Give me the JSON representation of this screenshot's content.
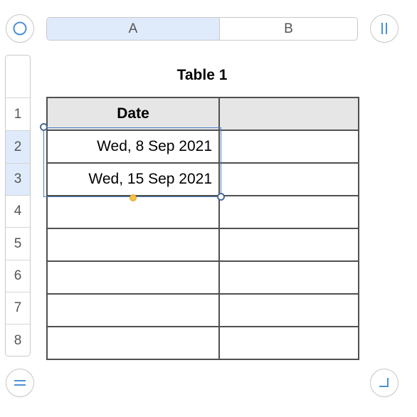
{
  "table": {
    "title": "Table 1",
    "column_headers": [
      "A",
      "B"
    ],
    "row_headers": [
      "",
      "1",
      "2",
      "3",
      "4",
      "5",
      "6",
      "7",
      "8"
    ],
    "header_row": {
      "a": "Date",
      "b": ""
    },
    "rows": [
      {
        "a": "Wed, 8 Sep 2021",
        "b": ""
      },
      {
        "a": "Wed, 15 Sep 2021",
        "b": ""
      },
      {
        "a": "",
        "b": ""
      },
      {
        "a": "",
        "b": ""
      },
      {
        "a": "",
        "b": ""
      },
      {
        "a": "",
        "b": ""
      },
      {
        "a": "",
        "b": ""
      }
    ]
  },
  "selection": {
    "range": "A2:A3",
    "color": "#4a7fc1"
  },
  "controls": {
    "select_table_icon": "circle-icon",
    "column_handle_icon": "pause-bars-icon",
    "row_handle_icon": "equals-bars-icon",
    "resize_icon": "corner-resize-icon"
  },
  "colors": {
    "accent": "#4a90d9",
    "header_selected": "#dfeafb",
    "header_fill": "#e6e6e6",
    "autofill": "#f5c243"
  }
}
